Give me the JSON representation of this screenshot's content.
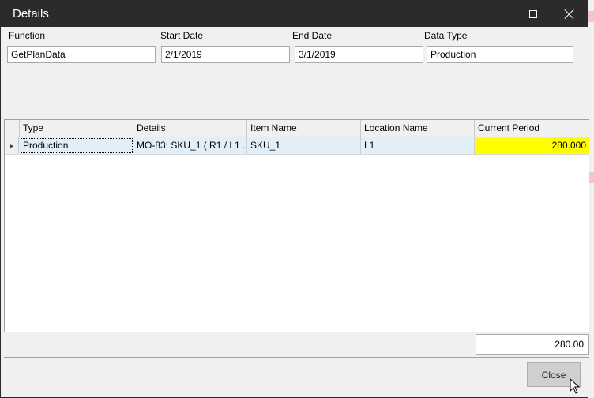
{
  "window": {
    "title": "Details"
  },
  "fields": [
    {
      "label": "Function",
      "value": "GetPlanData"
    },
    {
      "label": "Start Date",
      "value": "2/1/2019"
    },
    {
      "label": "End  Date",
      "value": "3/1/2019"
    },
    {
      "label": "Data Type",
      "value": "Production"
    }
  ],
  "grid": {
    "columns": [
      "Type",
      "Details",
      "Item Name",
      "Location Name",
      "Current Period"
    ],
    "rows": [
      {
        "type": "Production",
        "details": "MO-83: SKU_1 ( R1 / L1 ...",
        "item_name": "SKU_1",
        "location_name": "L1",
        "current_period": "280.000"
      }
    ]
  },
  "footer": {
    "total": "280.00",
    "close_label": "Close"
  },
  "colors": {
    "titlebar": "#2b2b2b",
    "highlight": "#ffff00",
    "selected_row": "#e2eef8"
  },
  "icons": {
    "maximize": "maximize-icon",
    "close": "close-icon",
    "row_indicator": "triangle-right-icon",
    "cursor": "mouse-pointer-icon"
  }
}
